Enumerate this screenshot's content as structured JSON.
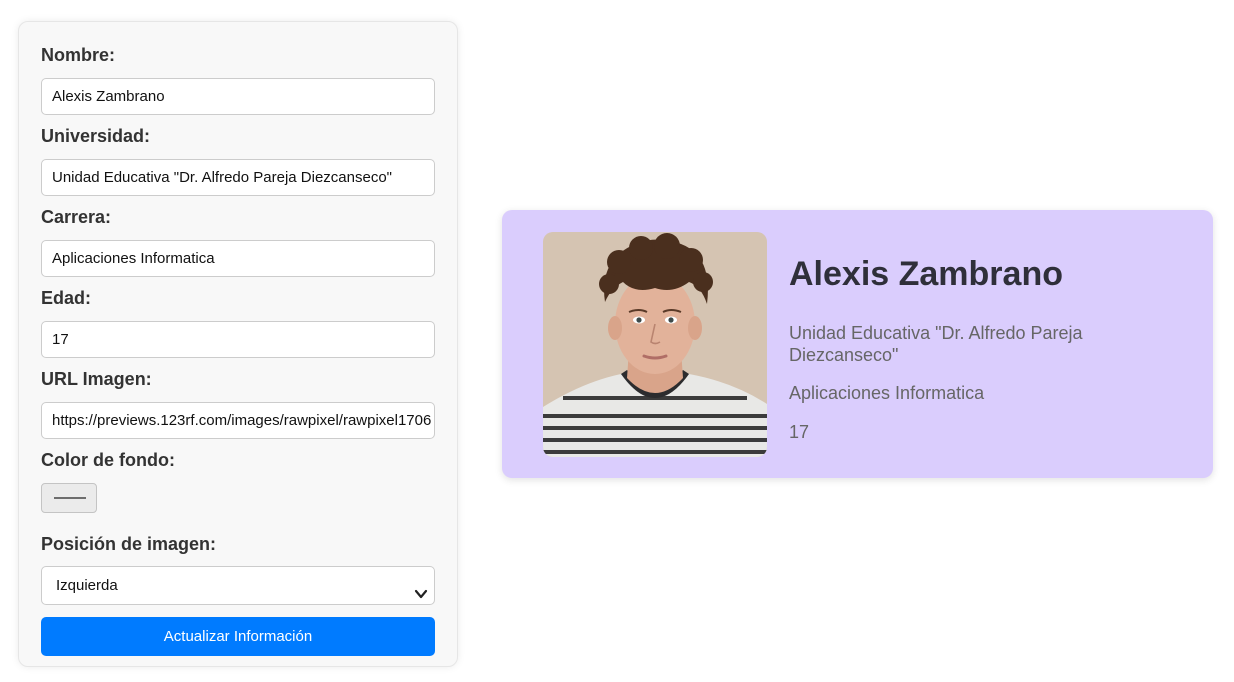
{
  "form": {
    "name_label": "Nombre:",
    "name_value": "Alexis Zambrano",
    "university_label": "Universidad:",
    "university_value": "Unidad Educativa \"Dr. Alfredo Pareja Diezcanseco\"",
    "career_label": "Carrera:",
    "career_value": "Aplicaciones Informatica",
    "age_label": "Edad:",
    "age_value": "17",
    "image_url_label": "URL Imagen:",
    "image_url_value": "https://previews.123rf.com/images/rawpixel/rawpixel1706",
    "bg_color_label": "Color de fondo:",
    "bg_color_value": "#dacdfd",
    "image_position_label": "Posición de imagen:",
    "image_position_value": "Izquierda",
    "submit_label": "Actualizar Información"
  },
  "card": {
    "name": "Alexis Zambrano",
    "university": "Unidad Educativa \"Dr. Alfredo Pareja Diezcanseco\"",
    "career": "Aplicaciones Informatica",
    "age": "17",
    "background_color": "#dacdfd",
    "photo": "portrait-photo"
  },
  "icons": {
    "select": "chevron-down-icon"
  },
  "colors": {
    "accent": "#007bff",
    "panel_background": "#f8f8f8"
  }
}
